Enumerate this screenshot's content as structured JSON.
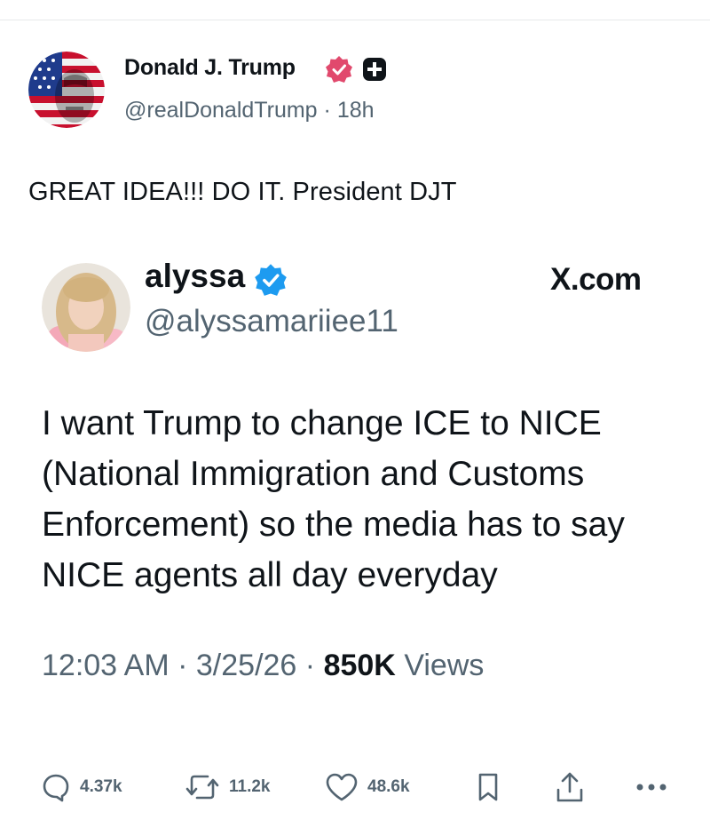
{
  "post": {
    "author": {
      "display_name": "Donald J. Trump",
      "handle": "@realDonaldTrump",
      "time_ago": "18h",
      "separator": "·"
    },
    "text": "GREAT IDEA!!! DO IT.  President DJT"
  },
  "embedded": {
    "author": {
      "display_name": "alyssa",
      "handle": "@alyssamariiee11"
    },
    "source_label": "X.com",
    "text_lines": [
      "I want Trump to change ICE to NICE",
      "(National Immigration and Customs",
      "Enforcement) so the media has to say",
      "NICE agents all day everyday"
    ],
    "meta": {
      "time": "12:03 AM",
      "date": "3/25/26",
      "views_count": "850K",
      "views_label": "Views",
      "separator": "·"
    }
  },
  "actions": {
    "replies": "4.37k",
    "reposts": "11.2k",
    "likes": "48.6k"
  },
  "colors": {
    "text": "#0f1419",
    "secondary": "#536471",
    "verified_blue": "#1d9bf0",
    "truth_badge": "#e1496d"
  }
}
